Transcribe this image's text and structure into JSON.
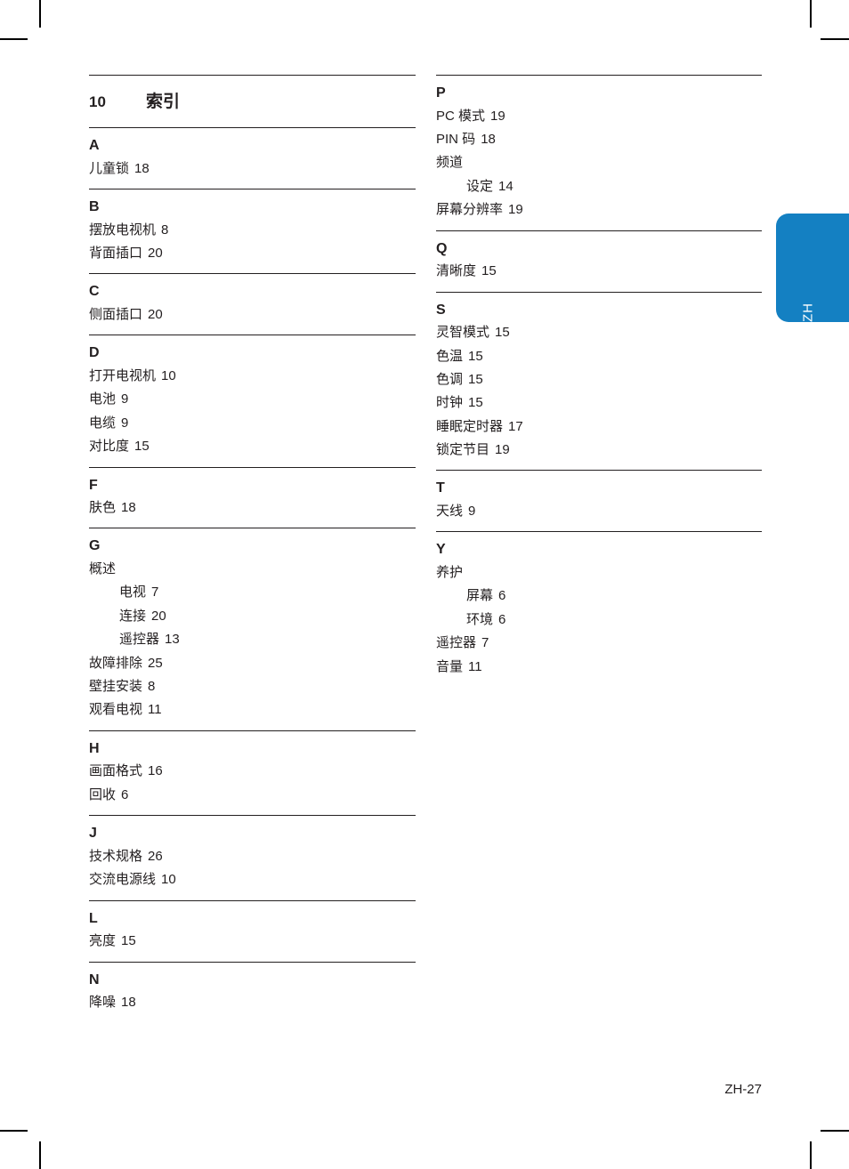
{
  "page": {
    "chapter_number": "10",
    "chapter_title": "索引",
    "footer": "ZH-27",
    "side_tab_label": "ZH",
    "accent_color": "#1480c2",
    "text_color": "#231f20"
  },
  "columns": [
    {
      "id": "left",
      "sections": [
        {
          "letter": "A",
          "entries": [
            {
              "term": "儿童锁",
              "page": "18",
              "level": 0
            }
          ]
        },
        {
          "letter": "B",
          "entries": [
            {
              "term": "摆放电视机",
              "page": "8",
              "level": 0
            },
            {
              "term": "背面插口",
              "page": "20",
              "level": 0
            }
          ]
        },
        {
          "letter": "C",
          "entries": [
            {
              "term": "侧面插口",
              "page": "20",
              "level": 0
            }
          ]
        },
        {
          "letter": "D",
          "entries": [
            {
              "term": "打开电视机",
              "page": "10",
              "level": 0
            },
            {
              "term": "电池",
              "page": "9",
              "level": 0
            },
            {
              "term": "电缆",
              "page": "9",
              "level": 0
            },
            {
              "term": "对比度",
              "page": "15",
              "level": 0
            }
          ]
        },
        {
          "letter": "F",
          "entries": [
            {
              "term": "肤色",
              "page": "18",
              "level": 0
            }
          ]
        },
        {
          "letter": "G",
          "entries": [
            {
              "term": "概述",
              "page": "",
              "level": 0
            },
            {
              "term": "电视",
              "page": "7",
              "level": 1
            },
            {
              "term": "连接",
              "page": "20",
              "level": 1
            },
            {
              "term": "遥控器",
              "page": "13",
              "level": 1
            },
            {
              "term": "故障排除",
              "page": "25",
              "level": 0
            },
            {
              "term": "壁挂安装",
              "page": "8",
              "level": 0
            },
            {
              "term": "观看电视",
              "page": "11",
              "level": 0
            }
          ]
        },
        {
          "letter": "H",
          "entries": [
            {
              "term": "画面格式",
              "page": "16",
              "level": 0
            },
            {
              "term": "回收",
              "page": "6",
              "level": 0
            }
          ]
        },
        {
          "letter": "J",
          "entries": [
            {
              "term": "技术规格",
              "page": "26",
              "level": 0
            },
            {
              "term": "交流电源线",
              "page": "10",
              "level": 0
            }
          ]
        },
        {
          "letter": "L",
          "entries": [
            {
              "term": "亮度",
              "page": "15",
              "level": 0
            }
          ]
        },
        {
          "letter": "N",
          "entries": [
            {
              "term": "降噪",
              "page": "18",
              "level": 0
            }
          ]
        }
      ]
    },
    {
      "id": "right",
      "sections": [
        {
          "letter": "P",
          "entries": [
            {
              "term": "PC 模式",
              "page": "19",
              "level": 0
            },
            {
              "term": "PIN 码",
              "page": "18",
              "level": 0
            },
            {
              "term": "频道",
              "page": "",
              "level": 0
            },
            {
              "term": "设定",
              "page": "14",
              "level": 1
            },
            {
              "term": "屏幕分辨率",
              "page": "19",
              "level": 0
            }
          ]
        },
        {
          "letter": "Q",
          "entries": [
            {
              "term": "清晰度",
              "page": "15",
              "level": 0
            }
          ]
        },
        {
          "letter": "S",
          "entries": [
            {
              "term": "灵智模式",
              "page": "15",
              "level": 0
            },
            {
              "term": "色温",
              "page": "15",
              "level": 0
            },
            {
              "term": "色调",
              "page": "15",
              "level": 0
            },
            {
              "term": "时钟",
              "page": "15",
              "level": 0
            },
            {
              "term": "睡眠定时器",
              "page": "17",
              "level": 0
            },
            {
              "term": "锁定节目",
              "page": "19",
              "level": 0
            }
          ]
        },
        {
          "letter": "T",
          "entries": [
            {
              "term": "天线",
              "page": "9",
              "level": 0
            }
          ]
        },
        {
          "letter": "Y",
          "entries": [
            {
              "term": "养护",
              "page": "",
              "level": 0
            },
            {
              "term": "屏幕",
              "page": "6",
              "level": 1
            },
            {
              "term": "环境",
              "page": "6",
              "level": 1
            },
            {
              "term": "遥控器",
              "page": "7",
              "level": 0
            },
            {
              "term": "音量",
              "page": "11",
              "level": 0
            }
          ]
        }
      ]
    }
  ]
}
